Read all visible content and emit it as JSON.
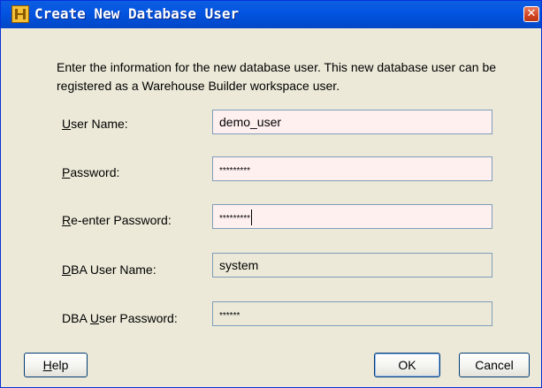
{
  "window": {
    "title": "Create New Database User",
    "close_glyph": "✕",
    "icon": "app-icon"
  },
  "intro_text": "Enter the information for the new database user. This new database user can be registered as a Warehouse Builder workspace user.",
  "form": {
    "user_name": {
      "label_mnemonic": "U",
      "label_rest": "ser Name:",
      "value": "demo_user"
    },
    "password": {
      "label_mnemonic": "P",
      "label_rest": "assword:",
      "value": "*********"
    },
    "reenter_password": {
      "label_mnemonic": "R",
      "label_rest": "e-enter Password:",
      "value": "*********"
    },
    "dba_user_name": {
      "label_mnemonic": "D",
      "label_rest": "BA User Name:",
      "value": "system"
    },
    "dba_user_password": {
      "label_prefix": "DBA ",
      "label_mnemonic": "U",
      "label_rest": "ser Password:",
      "value": "******"
    }
  },
  "buttons": {
    "help": {
      "mnemonic": "H",
      "rest": "elp"
    },
    "ok": {
      "label": "OK"
    },
    "cancel": {
      "label": "Cancel"
    }
  },
  "colors": {
    "titlebar": "#0150d8",
    "dialog_bg": "#ece9d8",
    "editable_field_bg": "#fff0f0",
    "field_border": "#7f9db9"
  }
}
